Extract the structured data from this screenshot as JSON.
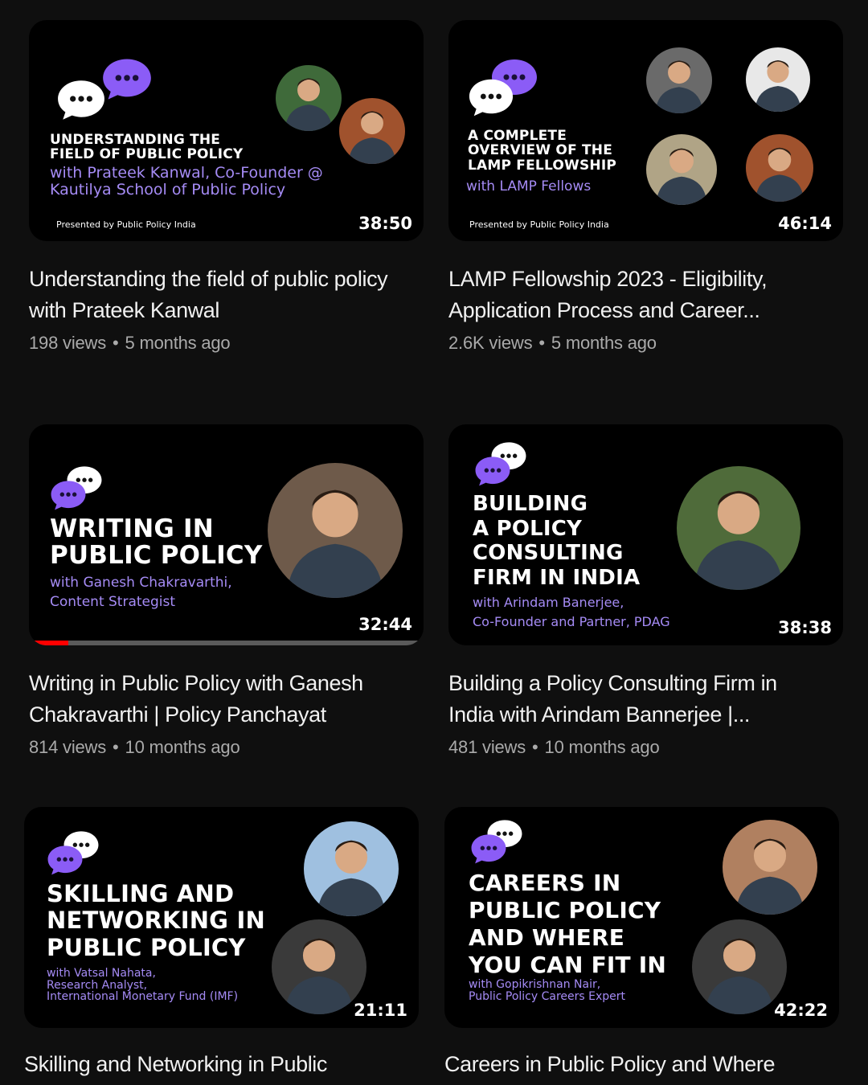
{
  "branding": {
    "presented_by": "Presented by Public Policy India",
    "accent_purple": "#8b5cf6",
    "progress_red": "#ff0000"
  },
  "videos": [
    {
      "thumb_title": "UNDERSTANDING THE\nFIELD OF PUBLIC POLICY",
      "thumb_subtitle": "with Prateek Kanwal, Co-Founder @\nKautilya School of Public Policy",
      "duration": "38:50",
      "title": "Understanding the field of public policy with Prateek Kanwal",
      "views": "198 views",
      "age": "5 months ago"
    },
    {
      "thumb_title": "A COMPLETE\nOVERVIEW OF THE\nLAMP FELLOWSHIP",
      "thumb_subtitle": "with LAMP Fellows",
      "duration": "46:14",
      "title": "LAMP Fellowship 2023 - Eligibility, Application Process and Career...",
      "views": "2.6K views",
      "age": "5 months ago"
    },
    {
      "thumb_title": "WRITING IN\nPUBLIC POLICY",
      "thumb_subtitle": "with Ganesh Chakravarthi,\nContent Strategist",
      "duration": "32:44",
      "title": "Writing in Public Policy with Ganesh Chakravarthi | Policy Panchayat",
      "views": "814 views",
      "age": "10 months ago",
      "watched_fraction": 0.09
    },
    {
      "thumb_title": "BUILDING\nA POLICY\nCONSULTING\nFIRM IN INDIA",
      "thumb_subtitle": "with Arindam Banerjee,\nCo-Founder and Partner, PDAG",
      "duration": "38:38",
      "title": "Building a Policy Consulting Firm in India with Arindam Bannerjee |...",
      "views": "481 views",
      "age": "10 months ago"
    },
    {
      "thumb_title": "SKILLING AND\nNETWORKING IN\nPUBLIC POLICY",
      "thumb_subtitle": "with Vatsal Nahata,\nResearch Analyst,\nInternational Monetary Fund (IMF)",
      "duration": "21:11",
      "title": "Skilling and Networking in Public",
      "views": "",
      "age": ""
    },
    {
      "thumb_title": "CAREERS IN\nPUBLIC POLICY\nAND WHERE\nYOU CAN FIT IN",
      "thumb_subtitle": "with Gopikrishnan Nair,\nPublic Policy Careers Expert",
      "duration": "42:22",
      "title": "Careers in Public Policy and Where",
      "views": "",
      "age": ""
    }
  ]
}
